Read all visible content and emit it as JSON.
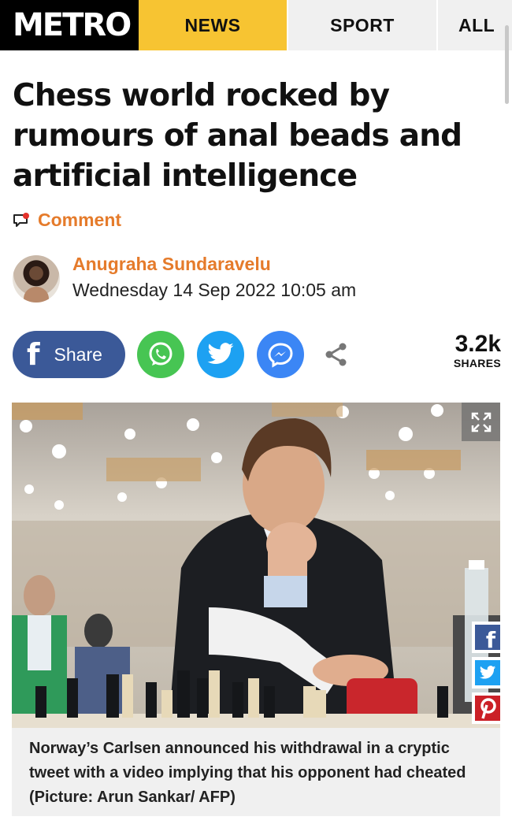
{
  "nav": {
    "logo": "METRO",
    "tabs": [
      {
        "label": "NEWS",
        "active": true
      },
      {
        "label": "SPORT",
        "active": false
      },
      {
        "label": "ALL",
        "active": false
      }
    ]
  },
  "article": {
    "headline": "Chess world rocked by rumours of anal beads and artificial intelligence",
    "comment_label": "Comment",
    "author": "Anugraha Sundaravelu",
    "date": "Wednesday 14 Sep 2022 10:05 am"
  },
  "share": {
    "facebook_label": "Share",
    "count": "3.2k",
    "count_label": "SHARES",
    "icons": [
      "facebook-icon",
      "whatsapp-icon",
      "twitter-icon",
      "messenger-icon",
      "share-icon"
    ]
  },
  "image": {
    "caption": "Norway’s Carlsen announced his withdrawal in a cryptic tweet with a video implying that his opponent had cheated (Picture: Arun Sankar/ AFP)",
    "side_share_icons": [
      "facebook-icon",
      "twitter-icon",
      "pinterest-icon"
    ]
  },
  "colors": {
    "accent": "#e57b2b",
    "news_tab": "#f7c432",
    "facebook": "#3b5998",
    "whatsapp": "#47c553",
    "twitter": "#1da1f2",
    "messenger": "#3b86f5",
    "pinterest": "#cb2027"
  }
}
